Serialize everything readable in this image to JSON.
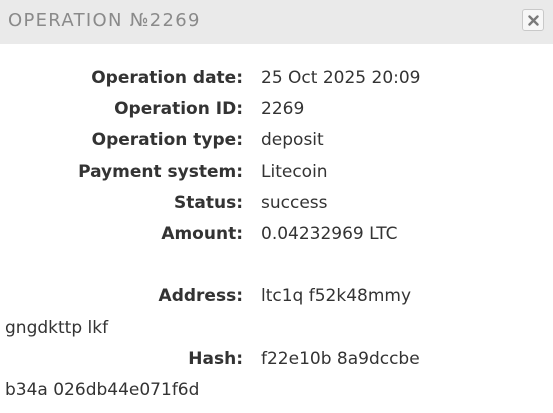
{
  "modal": {
    "title": "OPERATION №2269",
    "close_icon": "close-x-icon"
  },
  "details": {
    "operation_date_label": "Operation date:",
    "operation_date_value": "25 Oct 2025 20:09",
    "operation_id_label": "Operation ID:",
    "operation_id_value": "2269",
    "operation_type_label": "Operation type:",
    "operation_type_value": "deposit",
    "payment_system_label": "Payment system:",
    "payment_system_value": "Litecoin",
    "status_label": "Status:",
    "status_value": "success",
    "amount_label": "Amount:",
    "amount_value": "0.04232969 LTC",
    "address_label": "Address:",
    "address_value_line1": "ltc1q          f52k48mmy",
    "address_value_line2": "gngdkttp     lkf",
    "hash_label": "Hash:",
    "hash_value_line1": "f22e10b          8a9dccbe",
    "hash_value_line2": "b34a          026db44e071f6d   "
  }
}
